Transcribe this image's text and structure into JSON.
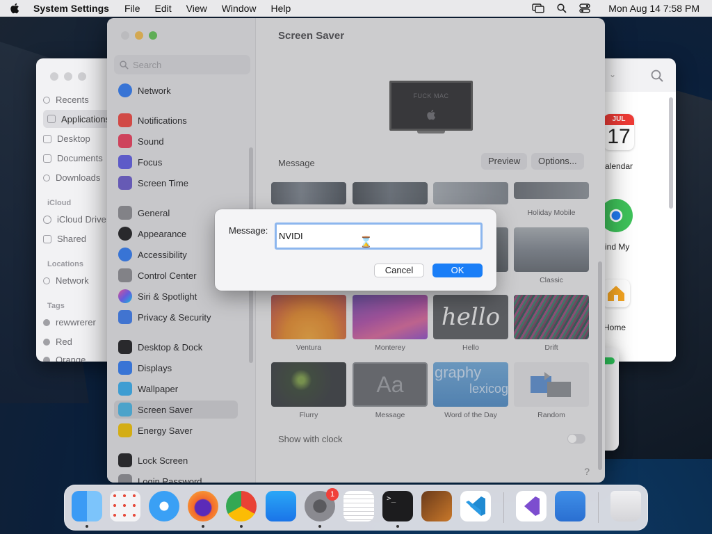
{
  "menubar": {
    "app_name": "System Settings",
    "items": [
      "File",
      "Edit",
      "View",
      "Window",
      "Help"
    ],
    "clock": "Mon Aug 14  7:58 PM"
  },
  "finder": {
    "sidebar": {
      "favorites": [
        "Recents",
        "Applications",
        "Desktop",
        "Documents",
        "Downloads"
      ],
      "icloud_header": "iCloud",
      "icloud": [
        "iCloud Drive",
        "Shared"
      ],
      "locations_header": "Locations",
      "locations": [
        "Network"
      ],
      "tags_header": "Tags",
      "tags": [
        "rewwrerer",
        "Red",
        "Orange"
      ]
    },
    "apps": {
      "calendar_month": "JUL",
      "calendar_day": "17",
      "calendar_label": "alendar",
      "findmy_label": "ind My",
      "home_label": "Home"
    }
  },
  "settings": {
    "search_placeholder": "Search",
    "sidebar": [
      {
        "label": "Network",
        "color": "#2f7cf6"
      },
      {
        "label": "Notifications",
        "color": "#f2463f"
      },
      {
        "label": "Sound",
        "color": "#ef3d5b"
      },
      {
        "label": "Focus",
        "color": "#5e5ce6"
      },
      {
        "label": "Screen Time",
        "color": "#6a5acd"
      },
      {
        "label": "General",
        "color": "#8e8e93"
      },
      {
        "label": "Appearance",
        "color": "#1c1c1e"
      },
      {
        "label": "Accessibility",
        "color": "#2f7cf6"
      },
      {
        "label": "Control Center",
        "color": "#8e8e93"
      },
      {
        "label": "Siri & Spotlight",
        "color": "#c84fd8"
      },
      {
        "label": "Privacy & Security",
        "color": "#3a7bf0"
      },
      {
        "label": "Desktop & Dock",
        "color": "#1c1c1e"
      },
      {
        "label": "Displays",
        "color": "#2f7cf6"
      },
      {
        "label": "Wallpaper",
        "color": "#36b0f2"
      },
      {
        "label": "Screen Saver",
        "color": "#48b8e8"
      },
      {
        "label": "Energy Saver",
        "color": "#f5c400"
      },
      {
        "label": "Lock Screen",
        "color": "#1c1c1e"
      },
      {
        "label": "Login Password",
        "color": "#8e8e93"
      }
    ],
    "content": {
      "title": "Screen Saver",
      "preview_text": "FUCK MAC",
      "message_label": "Message",
      "preview_button": "Preview",
      "options_button": "Options...",
      "row1_labels": [
        "",
        "",
        "",
        "Holiday Mobile"
      ],
      "row2_labels": [
        "",
        "",
        "",
        "Classic"
      ],
      "row3_labels": [
        "Ventura",
        "Monterey",
        "Hello",
        "Drift"
      ],
      "hello_text": "hello",
      "row4_labels": [
        "Flurry",
        "Message",
        "Word of the Day",
        "Random"
      ],
      "message_thumb_text": "Aa",
      "word_thumb_text1": "graphy",
      "word_thumb_text2": "lexicog",
      "show_with_clock": "Show with clock",
      "help": "?"
    }
  },
  "dialog": {
    "label": "Message:",
    "value": "NVIDI",
    "cancel": "Cancel",
    "ok": "OK"
  },
  "dock": {
    "badge": "1"
  }
}
